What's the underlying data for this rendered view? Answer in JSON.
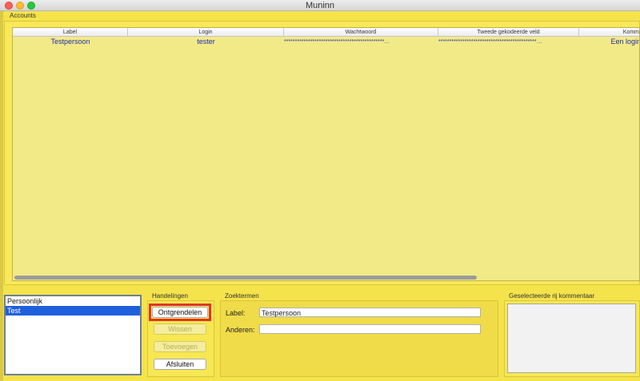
{
  "window": {
    "title": "Muninn"
  },
  "accounts": {
    "title": "Accounts",
    "columns": [
      "Label",
      "Login",
      "Wachtwoord",
      "Tweede gekodeerde veld",
      "Komm"
    ],
    "rows": [
      {
        "label": "Testpersoon",
        "login": "tester",
        "password": "**********************************************…",
        "second": "*********************************************…",
        "comment": "Een login"
      }
    ]
  },
  "categories": {
    "items": [
      "Persoonlijk",
      "Test"
    ],
    "selected_index": 1
  },
  "handelingen": {
    "title": "Handelingen",
    "unlock": "Ontgrendelen",
    "delete": "Wissen",
    "add": "Toevoegen",
    "close": "Afsluiten"
  },
  "zoektermen": {
    "title": "Zoektermen",
    "label_caption": "Label:",
    "label_value": "Testpersoon",
    "others_caption": "Anderen:",
    "others_value": ""
  },
  "comment": {
    "title": "Geselecteerde rij kommentaar",
    "value": ""
  },
  "colors": {
    "highlight": "#e03527",
    "selection": "#1f5fdc",
    "row_text": "#1e2fa8"
  }
}
